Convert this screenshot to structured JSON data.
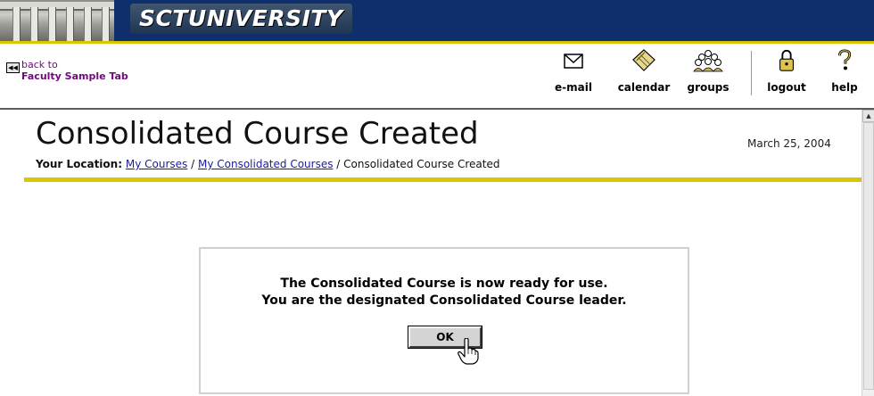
{
  "banner": {
    "university_name": "SCTUNIVERSITY",
    "colors": {
      "background": "#0e2f6c",
      "accent_line": "#d7c800"
    }
  },
  "toolbar": {
    "back": {
      "arrow_icon": "rewind-icon",
      "line1": "back to",
      "line2": "Faculty Sample Tab"
    },
    "items": [
      {
        "label": "e-mail",
        "icon": "envelope-icon"
      },
      {
        "label": "calendar",
        "icon": "calendar-icon"
      },
      {
        "label": "groups",
        "icon": "people-icon"
      },
      {
        "label": "logout",
        "icon": "padlock-icon"
      },
      {
        "label": "help",
        "icon": "question-mark-icon"
      }
    ]
  },
  "page": {
    "title": "Consolidated Course Created",
    "date": "March 25, 2004",
    "breadcrumb": {
      "prefix": "Your Location:",
      "link1": "My Courses",
      "sep1": "/",
      "link2": "My Consolidated Courses",
      "sep2": "/",
      "current": "Consolidated Course Created"
    }
  },
  "message": {
    "line1": "The Consolidated Course is now ready for use.",
    "line2": "You are the designated Consolidated Course leader.",
    "ok_label": "OK"
  },
  "colors": {
    "link": "#1a1aa6",
    "back_link": "#6e0a7a",
    "rule": "#d7c800"
  }
}
